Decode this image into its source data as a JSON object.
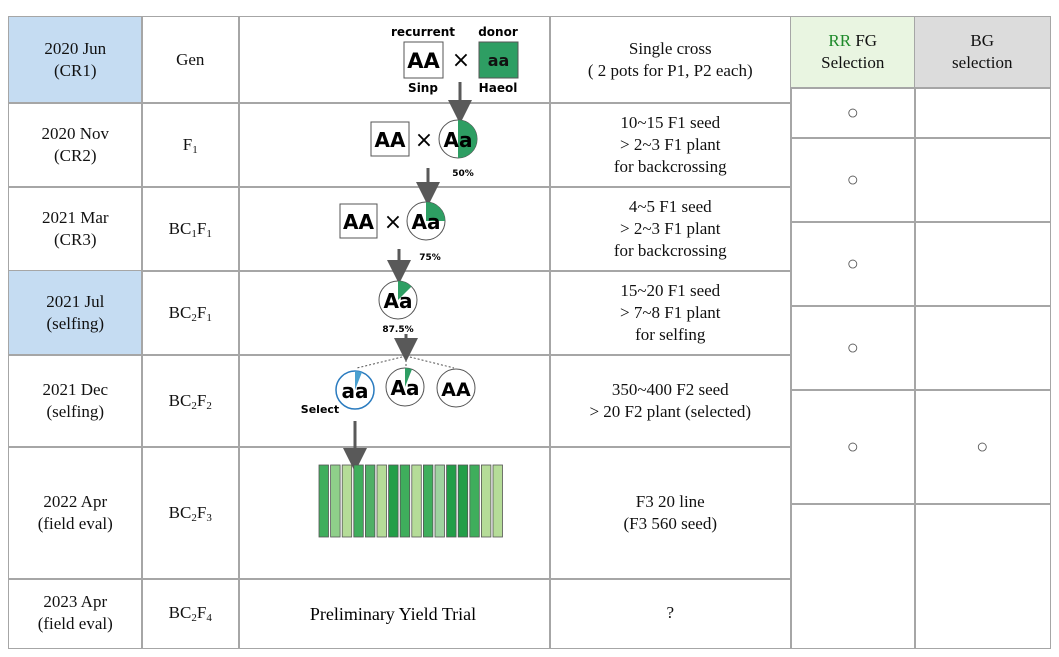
{
  "colors": {
    "highlight_blue": "#c5dcf2",
    "fg_header_bg": "#e9f5e1",
    "bg_header_bg": "#dcdcdc",
    "rr_green": "#1e8a2a",
    "allele_green": "#2e9e63",
    "select_blue": "#2a7bbf",
    "border": "#a6a6a6",
    "arrow": "#595959"
  },
  "rows": [
    {
      "period": "2020 Jun\n(CR1)",
      "highlight": true,
      "gen": [
        {
          "t": "Gen",
          "s": ""
        }
      ],
      "desc": "Single cross\n( 2 pots for P1, P2 each)"
    },
    {
      "period": "2020 Nov\n(CR2)",
      "highlight": false,
      "gen": [
        {
          "t": "F",
          "s": "1"
        }
      ],
      "desc": "10~15 F1 seed\n> 2~3 F1 plant\nfor backcrossing"
    },
    {
      "period": "2021 Mar\n(CR3)",
      "highlight": false,
      "gen": [
        {
          "t": "BC",
          "s": "1"
        },
        {
          "t": "F",
          "s": "1"
        }
      ],
      "desc": "4~5 F1 seed\n> 2~3 F1 plant\nfor backcrossing"
    },
    {
      "period": "2021 Jul\n(selfing)",
      "highlight": true,
      "gen": [
        {
          "t": "BC",
          "s": "2"
        },
        {
          "t": "F",
          "s": "1"
        }
      ],
      "desc": "15~20 F1 seed\n> 7~8 F1 plant\n  for selfing"
    },
    {
      "period": "2021 Dec\n(selfing)",
      "highlight": false,
      "gen": [
        {
          "t": "BC",
          "s": "2"
        },
        {
          "t": "F",
          "s": "2"
        }
      ],
      "desc": "350~400 F2 seed\n> 20 F2 plant (selected)"
    },
    {
      "period": "2022 Apr\n(field eval)",
      "highlight": false,
      "gen": [
        {
          "t": "BC",
          "s": "2"
        },
        {
          "t": "F",
          "s": "3"
        }
      ],
      "desc": "F3 20 line\n(F3 560 seed)"
    },
    {
      "period": "2023 Apr\n(field eval)",
      "highlight": false,
      "gen": [
        {
          "t": "BC",
          "s": "2"
        },
        {
          "t": "F",
          "s": "4"
        }
      ],
      "desc": "?",
      "scheme_text": "Preliminary Yield Trial"
    }
  ],
  "selection": {
    "fg_header_rr": "RR",
    "fg_header_rest": " FG\nSelection",
    "bg_header": "BG\nselection",
    "mark": "○",
    "fg_marks": [
      true,
      true,
      true,
      true,
      true,
      false
    ],
    "bg_marks": [
      false,
      false,
      false,
      false,
      true,
      false
    ]
  },
  "scheme": {
    "recurrent_label": "recurrent",
    "donor_label": "donor",
    "recurrent_genotype": "AA",
    "donor_genotype": "aa",
    "recurrent_name": "Sinp",
    "donor_name": "Haeol",
    "cross_symbol": "×",
    "hetero_genotype": "Aa",
    "homo_genotype": "AA",
    "recessive_genotype": "aa",
    "pct_f1": "50%",
    "pct_bc1": "75%",
    "pct_bc2": "87.5%",
    "select_label": "Select",
    "line_colors": [
      "#3fae5c",
      "#8fcf8a",
      "#b5dc98",
      "#3fae5c",
      "#4fb066",
      "#b5dc98",
      "#229e48",
      "#3fae5c",
      "#b5dc98",
      "#3fae5c",
      "#9fd3a0",
      "#229e48",
      "#229e48",
      "#3fae5c",
      "#b5dc98",
      "#b5dc98"
    ]
  }
}
